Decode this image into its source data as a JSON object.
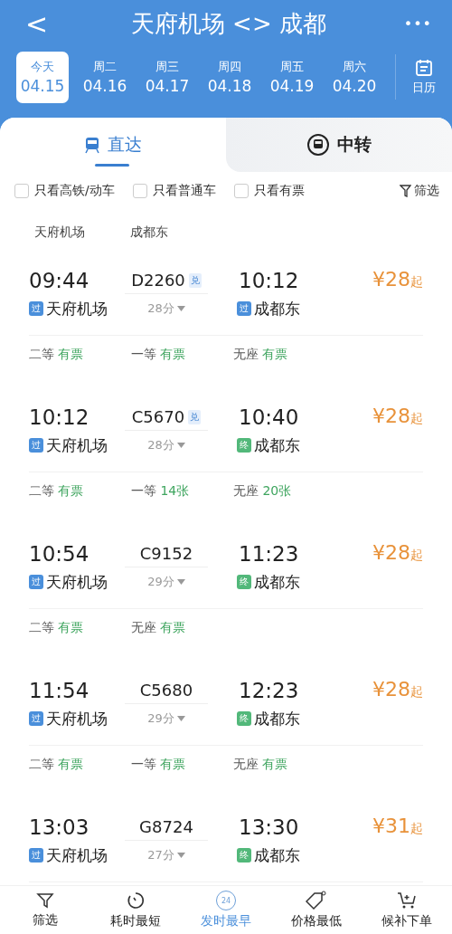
{
  "header": {
    "back": "<",
    "title": "天府机场 <> 成都",
    "more": "•••"
  },
  "dates": [
    {
      "weekday": "今天",
      "date": "04.15",
      "selected": true
    },
    {
      "weekday": "周二",
      "date": "04.16",
      "selected": false
    },
    {
      "weekday": "周三",
      "date": "04.17",
      "selected": false
    },
    {
      "weekday": "周四",
      "date": "04.18",
      "selected": false
    },
    {
      "weekday": "周五",
      "date": "04.19",
      "selected": false
    },
    {
      "weekday": "周六",
      "date": "04.20",
      "selected": false
    }
  ],
  "calendar": {
    "label": "日历"
  },
  "tabs": [
    {
      "label": "直达",
      "kind": "direct",
      "selected": true
    },
    {
      "label": "中转",
      "kind": "transfer",
      "selected": false
    }
  ],
  "filters": [
    {
      "label": "只看高铁/动车",
      "checked": false
    },
    {
      "label": "只看普通车",
      "checked": false
    },
    {
      "label": "只看有票",
      "checked": false
    }
  ],
  "filter_button": "筛选",
  "stations_header": {
    "from": "天府机场",
    "to": "成都东"
  },
  "trains": [
    {
      "depart": "09:44",
      "number": "D2260",
      "exchange": "兑",
      "arrive": "10:12",
      "from": "天府机场",
      "from_badge": {
        "text": "过",
        "kind": "pass"
      },
      "to": "成都东",
      "to_badge": {
        "text": "过",
        "kind": "pass"
      },
      "duration": "28分",
      "price": "¥28",
      "price_suffix": "起",
      "seats": [
        {
          "class": "二等",
          "status": "有票"
        },
        {
          "class": "一等",
          "status": "有票"
        },
        {
          "class": "无座",
          "status": "有票"
        }
      ]
    },
    {
      "depart": "10:12",
      "number": "C5670",
      "exchange": "兑",
      "arrive": "10:40",
      "from": "天府机场",
      "from_badge": {
        "text": "过",
        "kind": "pass"
      },
      "to": "成都东",
      "to_badge": {
        "text": "终",
        "kind": "terminal"
      },
      "duration": "28分",
      "price": "¥28",
      "price_suffix": "起",
      "seats": [
        {
          "class": "二等",
          "status": "有票"
        },
        {
          "class": "一等",
          "status": "14张"
        },
        {
          "class": "无座",
          "status": "20张"
        }
      ]
    },
    {
      "depart": "10:54",
      "number": "C9152",
      "arrive": "11:23",
      "from": "天府机场",
      "from_badge": {
        "text": "过",
        "kind": "pass"
      },
      "to": "成都东",
      "to_badge": {
        "text": "终",
        "kind": "terminal"
      },
      "duration": "29分",
      "price": "¥28",
      "price_suffix": "起",
      "seats": [
        {
          "class": "二等",
          "status": "有票"
        },
        {
          "class": "无座",
          "status": "有票"
        }
      ]
    },
    {
      "depart": "11:54",
      "number": "C5680",
      "arrive": "12:23",
      "from": "天府机场",
      "from_badge": {
        "text": "过",
        "kind": "pass"
      },
      "to": "成都东",
      "to_badge": {
        "text": "终",
        "kind": "terminal"
      },
      "duration": "29分",
      "price": "¥28",
      "price_suffix": "起",
      "seats": [
        {
          "class": "二等",
          "status": "有票"
        },
        {
          "class": "一等",
          "status": "有票"
        },
        {
          "class": "无座",
          "status": "有票"
        }
      ]
    },
    {
      "depart": "13:03",
      "number": "G8724",
      "arrive": "13:30",
      "from": "天府机场",
      "from_badge": {
        "text": "过",
        "kind": "pass"
      },
      "to": "成都东",
      "to_badge": {
        "text": "终",
        "kind": "terminal"
      },
      "duration": "27分",
      "price": "¥31",
      "price_suffix": "起"
    }
  ],
  "bottom_nav": [
    {
      "label": "筛选",
      "kind": "filter",
      "selected": false
    },
    {
      "label": "耗时最短",
      "kind": "timer",
      "selected": false
    },
    {
      "label": "发时最早",
      "kind": "clock24",
      "icon_text": "24",
      "selected": true
    },
    {
      "label": "价格最低",
      "kind": "tag",
      "selected": false
    },
    {
      "label": "候补下单",
      "kind": "cart",
      "selected": false
    }
  ]
}
